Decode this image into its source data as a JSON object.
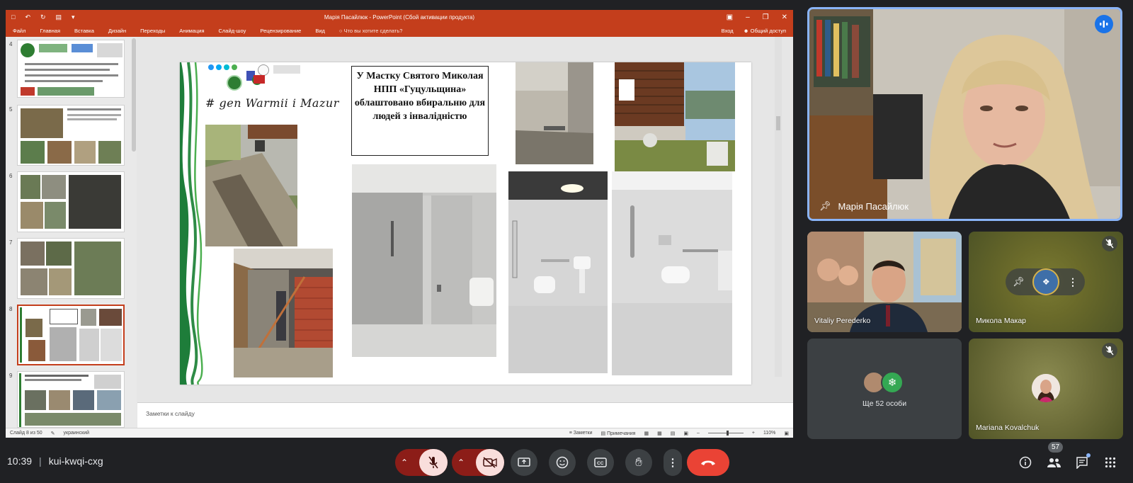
{
  "powerpoint": {
    "window_title": "Марія Пасайлюк - PowerPoint (Сбой активации продукта)",
    "ribbon_tabs": [
      "Файл",
      "Главная",
      "Вставка",
      "Дизайн",
      "Переходы",
      "Анимация",
      "Слайд-шоу",
      "Рецензирование",
      "Вид"
    ],
    "tell_me": "Что вы хотите сделать?",
    "signin": "Вход",
    "share": "Общий доступ",
    "thumb_numbers": [
      "4",
      "5",
      "6",
      "7",
      "8",
      "9"
    ],
    "selected_slide": 8,
    "slide": {
      "hashtag": "# gen Warmii i Mazur",
      "caption": "У Мастку Святого Миколая НПП «Гуцульщина» облаштовано вбиральню для людей з інвалідністю"
    },
    "notes_placeholder": "Заметки к слайду",
    "status": {
      "slide_counter": "Слайд 8 из 50",
      "language": "украинский",
      "notes_btn": "Заметки",
      "comments_btn": "Примечания",
      "zoom": "110%"
    }
  },
  "participants": {
    "main": {
      "name": "Марія Пасайлюк"
    },
    "tiles": [
      {
        "name": "Vitaliy Perederko"
      },
      {
        "name": "Микола Макар"
      },
      {
        "name": "Ще 52 особи"
      },
      {
        "name": "Mariana Kovalchuk"
      }
    ]
  },
  "bottombar": {
    "time": "10:39",
    "meeting_code": "kui-kwqi-cxg",
    "participant_count": "57"
  },
  "colors": {
    "pp_accent": "#c43e1c",
    "end_call": "#ea4335",
    "muted_bg": "#f9dedc",
    "meet_bg": "#202124",
    "active_speaker_border": "#8ab4f8"
  }
}
